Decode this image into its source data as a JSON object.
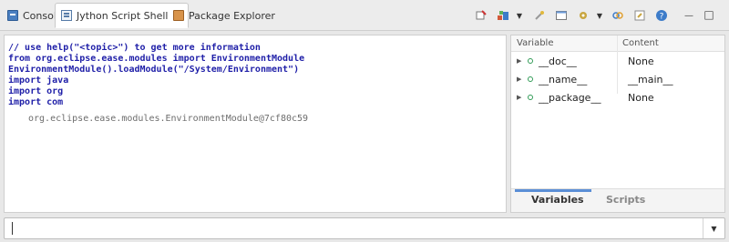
{
  "tabs": [
    {
      "label": "Console",
      "icon": "console-icon"
    },
    {
      "label": "Jython Script Shell",
      "icon": "script-shell-icon",
      "close": "⊠",
      "active": true
    },
    {
      "label": "Package Explorer",
      "icon": "package-explorer-icon"
    }
  ],
  "toolbar": {
    "icons": [
      "clear-icon",
      "reload-icon",
      "menu-caret",
      "pin-icon",
      "view-icon",
      "settings-icon",
      "menu-caret",
      "link-icon",
      "export-icon",
      "help-icon"
    ],
    "minimize": "—",
    "maximize": "□"
  },
  "editor": {
    "lines": [
      "// use help(\"<topic>\") to get more information",
      "from org.eclipse.ease.modules import EnvironmentModule",
      "EnvironmentModule().loadModule(\"/System/Environment\")",
      "import java",
      "import org",
      "import com"
    ],
    "result": "org.eclipse.ease.modules.EnvironmentModule@7cf80c59"
  },
  "variables": {
    "col_variable": "Variable",
    "col_content": "Content",
    "rows": [
      {
        "name": "__doc__",
        "value": "None"
      },
      {
        "name": "__name__",
        "value": "__main__"
      },
      {
        "name": "__package__",
        "value": "None"
      }
    ],
    "tab_variables": "Variables",
    "tab_scripts": "Scripts"
  },
  "input": {
    "value": ""
  },
  "colors": {
    "accent": "#5a8ed6",
    "code": "#1f1fa8",
    "result": "#6d6d6d",
    "var-dot": "#2f9a55"
  }
}
